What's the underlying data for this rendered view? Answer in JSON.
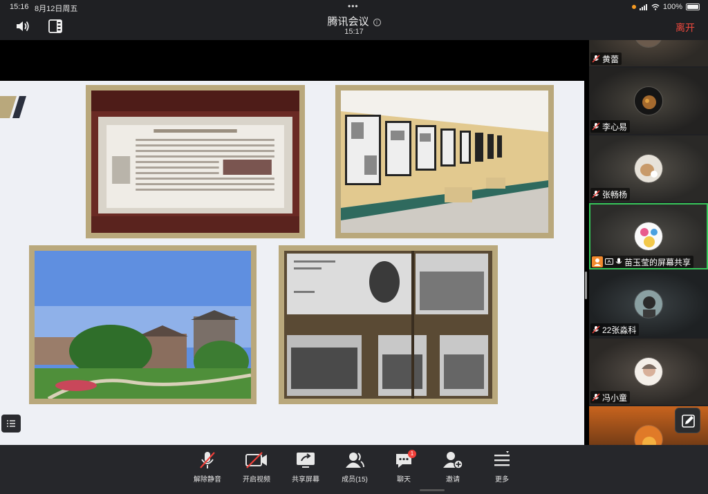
{
  "status_bar": {
    "time": "15:16",
    "date": "8月12日周五",
    "battery": "100%"
  },
  "header": {
    "title": "腾讯会议",
    "subtitle_time": "15:17",
    "leave_label": "离开"
  },
  "participants": [
    {
      "name": "黄蕾",
      "muted": true
    },
    {
      "name": "李心易",
      "muted": true
    },
    {
      "name": "张畅杨",
      "muted": true
    },
    {
      "name": "苗玉莹的屏幕共享",
      "muted": false,
      "active": true
    },
    {
      "name": "22张淼科",
      "muted": true
    },
    {
      "name": "冯小童",
      "muted": true
    },
    {
      "name": "",
      "muted": false
    }
  ],
  "toolbar": {
    "unmute": "解除静音",
    "start_video": "开启视频",
    "share_screen": "共享屏幕",
    "members": "成员(15)",
    "chat": "聊天",
    "chat_badge": "1",
    "invite": "邀请",
    "more": "更多"
  },
  "colors": {
    "leave": "#f0493e",
    "active_border": "#37c75a",
    "badge": "#f2403a",
    "frame": "#b9a87c"
  }
}
